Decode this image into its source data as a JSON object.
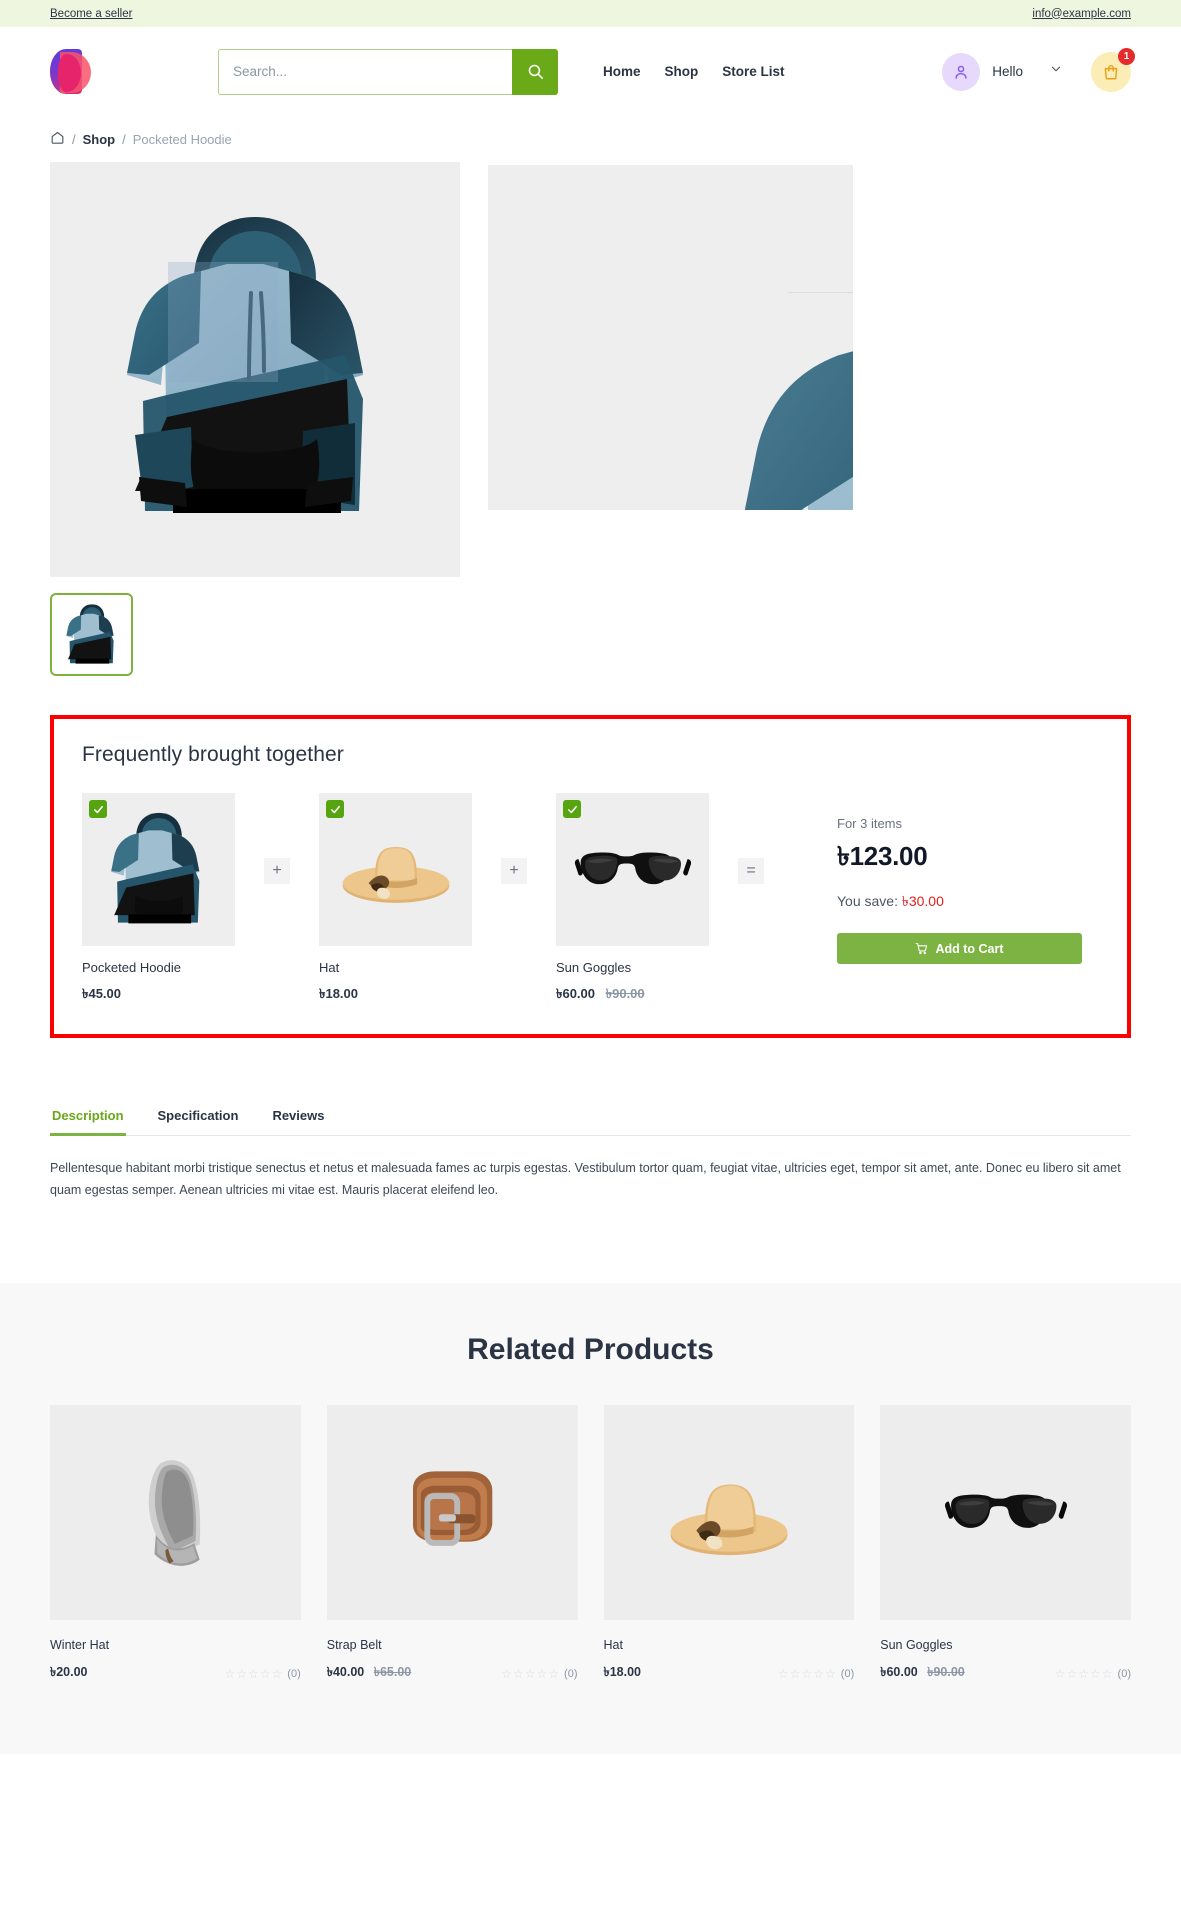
{
  "topbar": {
    "seller_link": "Become a seller",
    "email": "info@example.com"
  },
  "header": {
    "logo_name": "brand-logo",
    "search": {
      "placeholder": "Search...",
      "value": ""
    },
    "nav": [
      {
        "label": "Home"
      },
      {
        "label": "Shop"
      },
      {
        "label": "Store List"
      }
    ],
    "account": {
      "greeting": "Hello"
    },
    "cart": {
      "count": "1"
    }
  },
  "breadcrumb": {
    "home_icon": "home-icon",
    "sep": "/",
    "shop": "Shop",
    "current": "Pocketed Hoodie"
  },
  "gallery": {
    "main_alt": "Pocketed Hoodie",
    "thumbs": [
      {
        "alt": "Pocketed Hoodie thumbnail",
        "active": true
      }
    ]
  },
  "fbt": {
    "title": "Frequently brought together",
    "items": [
      {
        "name": "Pocketed Hoodie",
        "price": "৳45.00",
        "old_price": "",
        "checked": true,
        "image": "hoodie"
      },
      {
        "name": "Hat",
        "price": "৳18.00",
        "old_price": "",
        "checked": true,
        "image": "hat"
      },
      {
        "name": "Sun Goggles",
        "price": "৳60.00",
        "old_price": "৳90.00",
        "checked": true,
        "image": "goggles"
      }
    ],
    "operators": [
      "+",
      "+",
      "="
    ],
    "summary": {
      "items_label": "For 3 items",
      "total": "৳123.00",
      "save_label": "You save:",
      "save_amount": "৳30.00",
      "add_to_cart": "Add to Cart"
    }
  },
  "tabs": {
    "items": [
      {
        "label": "Description",
        "active": true
      },
      {
        "label": "Specification",
        "active": false
      },
      {
        "label": "Reviews",
        "active": false
      }
    ],
    "description": "Pellentesque habitant morbi tristique senectus et netus et malesuada fames ac turpis egestas. Vestibulum tortor quam, feugiat vitae, ultricies eget, tempor sit amet, ante. Donec eu libero sit amet quam egestas semper. Aenean ultricies mi vitae est. Mauris placerat eleifend leo."
  },
  "related": {
    "title": "Related Products",
    "products": [
      {
        "name": "Winter Hat",
        "price": "৳20.00",
        "old_price": "",
        "rating_count": "(0)",
        "image": "beanie"
      },
      {
        "name": "Strap Belt",
        "price": "৳40.00",
        "old_price": "৳65.00",
        "rating_count": "(0)",
        "image": "belt"
      },
      {
        "name": "Hat",
        "price": "৳18.00",
        "old_price": "",
        "rating_count": "(0)",
        "image": "hat"
      },
      {
        "name": "Sun Goggles",
        "price": "৳60.00",
        "old_price": "৳90.00",
        "rating_count": "(0)",
        "image": "goggles"
      }
    ]
  },
  "colors": {
    "accent_green": "#7cb342",
    "topbar_bg": "#eef6e0",
    "highlight_border": "#fc0000",
    "sale_red": "#e02020",
    "cart_badge": "#e32b2b"
  }
}
